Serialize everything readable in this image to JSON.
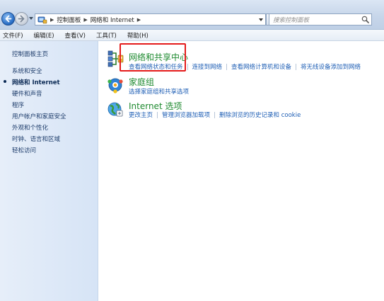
{
  "address": {
    "breadcrumbs": [
      "控制面板",
      "网络和 Internet"
    ],
    "search_placeholder": "搜索控制面板"
  },
  "menu": [
    "文件(F)",
    "编辑(E)",
    "查看(V)",
    "工具(T)",
    "帮助(H)"
  ],
  "sidebar": {
    "home": "控制面板主页",
    "items": [
      {
        "label": "系统和安全",
        "active": false
      },
      {
        "label": "网络和 Internet",
        "active": true
      },
      {
        "label": "硬件和声音",
        "active": false
      },
      {
        "label": "程序",
        "active": false
      },
      {
        "label": "用户帐户和家庭安全",
        "active": false
      },
      {
        "label": "外观和个性化",
        "active": false
      },
      {
        "label": "时钟、语言和区域",
        "active": false
      },
      {
        "label": "轻松访问",
        "active": false
      }
    ]
  },
  "categories": [
    {
      "title": "网络和共享中心",
      "icon": "network-sharing-icon",
      "links": [
        "查看网络状态和任务",
        "连接到网络",
        "查看网络计算机和设备",
        "将无线设备添加到网络"
      ]
    },
    {
      "title": "家庭组",
      "icon": "homegroup-icon",
      "links": [
        "选择家庭组和共享选项"
      ]
    },
    {
      "title": "Internet 选项",
      "icon": "internet-options-icon",
      "links": [
        "更改主页",
        "管理浏览器加载项",
        "删除浏览的历史记录和 cookie"
      ]
    }
  ],
  "colors": {
    "category_title": "#1e8a2f",
    "link": "#1f5fb5",
    "highlight": "#e41b1b"
  }
}
